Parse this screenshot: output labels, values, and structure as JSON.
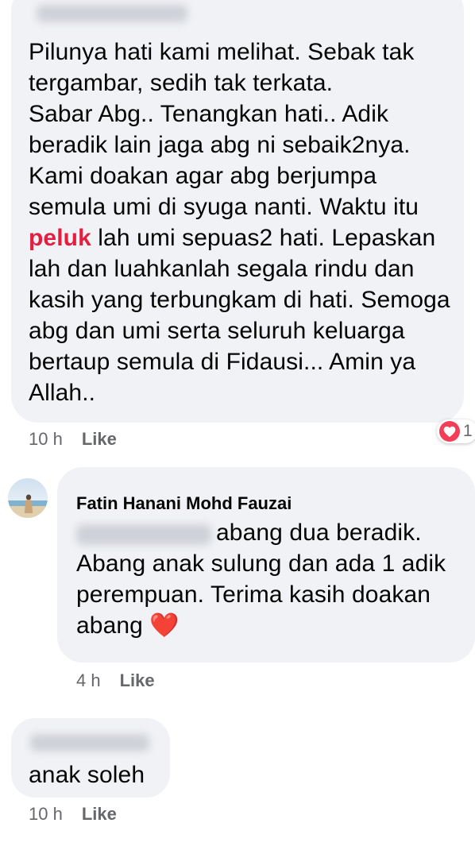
{
  "comments": [
    {
      "text_parts": [
        "Pilunya hati kami melihat. Sebak tak tergambar, sedih tak terkata.",
        "Sabar Abg.. Tenangkan hati.. Adik beradik lain jaga abg ni sebaik2nya. Kami doakan agar abg berjumpa semula umi di syuga nanti. Waktu itu",
        "peluk",
        "lah umi sepuas2 hati. Lepaskan lah dan luahkanlah segala rindu dan kasih yang terbungkam di hati. Semoga abg dan umi serta seluruh keluarga bertaup semula di Fidausi... Amin ya Allah.."
      ],
      "time": "10 h",
      "like_label": "Like",
      "reaction_icon": "love-heart-icon",
      "reaction_count": "1"
    },
    {
      "author": "Fatin Hanani Mohd Fauzai",
      "text_after_mention": "abang dua beradik. Abang anak sulung dan ada 1 adik perempuan. Terima kasih doakan abang",
      "emoji": "❤️",
      "time": "4 h",
      "like_label": "Like"
    },
    {
      "text": "anak soleh",
      "time": "10 h",
      "like_label": "Like"
    }
  ],
  "colors": {
    "bubble_bg": "#f0f2f5",
    "mention": "#e41e3f",
    "meta_text": "#65676b",
    "reaction_heart": "#f33e58"
  }
}
